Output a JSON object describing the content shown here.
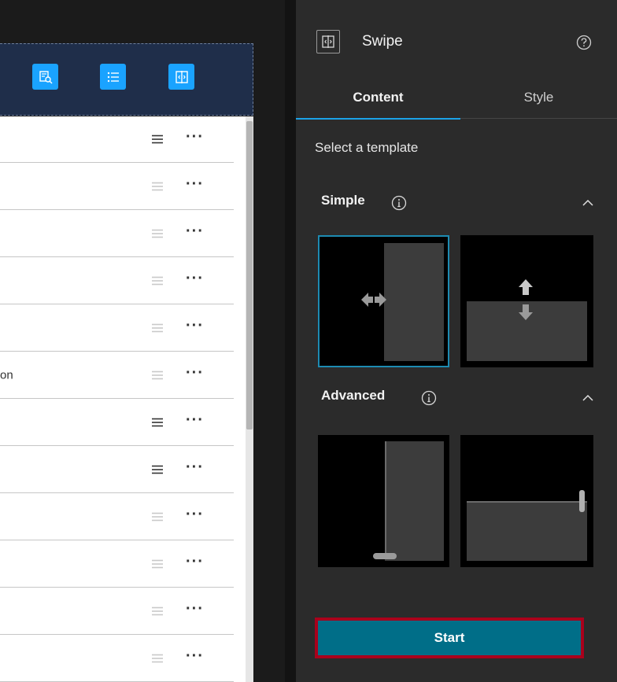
{
  "colors": {
    "accent": "#1ba3e8",
    "toolbar_button": "#1aa3ff",
    "start_button": "#006e88",
    "highlight_border": "#a9001c",
    "panel_background": "#2b2b2b"
  },
  "toolbar": {
    "buttons": [
      {
        "icon": "legend-search-icon"
      },
      {
        "icon": "layer-list-icon"
      },
      {
        "icon": "swipe-icon"
      }
    ]
  },
  "list": {
    "rows": [
      {
        "label": "",
        "handle_active": true
      },
      {
        "label": "",
        "handle_active": false
      },
      {
        "label": "",
        "handle_active": false
      },
      {
        "label": "",
        "handle_active": false
      },
      {
        "label": "",
        "handle_active": false
      },
      {
        "label": "on",
        "handle_active": false
      },
      {
        "label": "",
        "handle_active": true
      },
      {
        "label": "",
        "handle_active": true
      },
      {
        "label": "",
        "handle_active": false
      },
      {
        "label": "",
        "handle_active": false
      },
      {
        "label": "",
        "handle_active": false
      },
      {
        "label": "",
        "handle_active": false
      }
    ],
    "more_label": "···"
  },
  "panel": {
    "title": "Swipe",
    "title_icon": "swipe-icon",
    "help_icon": "help-icon",
    "tabs": [
      {
        "label": "Content",
        "active": true
      },
      {
        "label": "Style",
        "active": false
      }
    ],
    "select_label": "Select a template",
    "sections": {
      "simple": {
        "title": "Simple",
        "info_icon": "info-icon",
        "collapse_icon": "chevron-up-icon"
      },
      "advanced": {
        "title": "Advanced",
        "info_icon": "info-icon",
        "collapse_icon": "chevron-up-icon"
      }
    },
    "templates": [
      {
        "name": "simple-vertical",
        "selected": true
      },
      {
        "name": "simple-horizontal",
        "selected": false
      },
      {
        "name": "advanced-vertical",
        "selected": false
      },
      {
        "name": "advanced-horizontal",
        "selected": false
      }
    ],
    "start_label": "Start"
  }
}
